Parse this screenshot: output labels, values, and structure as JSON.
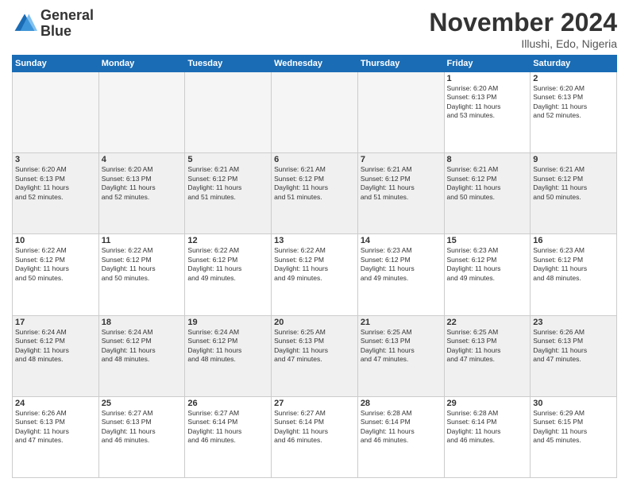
{
  "header": {
    "logo_line1": "General",
    "logo_line2": "Blue",
    "month": "November 2024",
    "location": "Illushi, Edo, Nigeria"
  },
  "weekdays": [
    "Sunday",
    "Monday",
    "Tuesday",
    "Wednesday",
    "Thursday",
    "Friday",
    "Saturday"
  ],
  "weeks": [
    [
      {
        "day": "",
        "text": ""
      },
      {
        "day": "",
        "text": ""
      },
      {
        "day": "",
        "text": ""
      },
      {
        "day": "",
        "text": ""
      },
      {
        "day": "",
        "text": ""
      },
      {
        "day": "1",
        "text": "Sunrise: 6:20 AM\nSunset: 6:13 PM\nDaylight: 11 hours\nand 53 minutes."
      },
      {
        "day": "2",
        "text": "Sunrise: 6:20 AM\nSunset: 6:13 PM\nDaylight: 11 hours\nand 52 minutes."
      }
    ],
    [
      {
        "day": "3",
        "text": "Sunrise: 6:20 AM\nSunset: 6:13 PM\nDaylight: 11 hours\nand 52 minutes."
      },
      {
        "day": "4",
        "text": "Sunrise: 6:20 AM\nSunset: 6:13 PM\nDaylight: 11 hours\nand 52 minutes."
      },
      {
        "day": "5",
        "text": "Sunrise: 6:21 AM\nSunset: 6:12 PM\nDaylight: 11 hours\nand 51 minutes."
      },
      {
        "day": "6",
        "text": "Sunrise: 6:21 AM\nSunset: 6:12 PM\nDaylight: 11 hours\nand 51 minutes."
      },
      {
        "day": "7",
        "text": "Sunrise: 6:21 AM\nSunset: 6:12 PM\nDaylight: 11 hours\nand 51 minutes."
      },
      {
        "day": "8",
        "text": "Sunrise: 6:21 AM\nSunset: 6:12 PM\nDaylight: 11 hours\nand 50 minutes."
      },
      {
        "day": "9",
        "text": "Sunrise: 6:21 AM\nSunset: 6:12 PM\nDaylight: 11 hours\nand 50 minutes."
      }
    ],
    [
      {
        "day": "10",
        "text": "Sunrise: 6:22 AM\nSunset: 6:12 PM\nDaylight: 11 hours\nand 50 minutes."
      },
      {
        "day": "11",
        "text": "Sunrise: 6:22 AM\nSunset: 6:12 PM\nDaylight: 11 hours\nand 50 minutes."
      },
      {
        "day": "12",
        "text": "Sunrise: 6:22 AM\nSunset: 6:12 PM\nDaylight: 11 hours\nand 49 minutes."
      },
      {
        "day": "13",
        "text": "Sunrise: 6:22 AM\nSunset: 6:12 PM\nDaylight: 11 hours\nand 49 minutes."
      },
      {
        "day": "14",
        "text": "Sunrise: 6:23 AM\nSunset: 6:12 PM\nDaylight: 11 hours\nand 49 minutes."
      },
      {
        "day": "15",
        "text": "Sunrise: 6:23 AM\nSunset: 6:12 PM\nDaylight: 11 hours\nand 49 minutes."
      },
      {
        "day": "16",
        "text": "Sunrise: 6:23 AM\nSunset: 6:12 PM\nDaylight: 11 hours\nand 48 minutes."
      }
    ],
    [
      {
        "day": "17",
        "text": "Sunrise: 6:24 AM\nSunset: 6:12 PM\nDaylight: 11 hours\nand 48 minutes."
      },
      {
        "day": "18",
        "text": "Sunrise: 6:24 AM\nSunset: 6:12 PM\nDaylight: 11 hours\nand 48 minutes."
      },
      {
        "day": "19",
        "text": "Sunrise: 6:24 AM\nSunset: 6:12 PM\nDaylight: 11 hours\nand 48 minutes."
      },
      {
        "day": "20",
        "text": "Sunrise: 6:25 AM\nSunset: 6:13 PM\nDaylight: 11 hours\nand 47 minutes."
      },
      {
        "day": "21",
        "text": "Sunrise: 6:25 AM\nSunset: 6:13 PM\nDaylight: 11 hours\nand 47 minutes."
      },
      {
        "day": "22",
        "text": "Sunrise: 6:25 AM\nSunset: 6:13 PM\nDaylight: 11 hours\nand 47 minutes."
      },
      {
        "day": "23",
        "text": "Sunrise: 6:26 AM\nSunset: 6:13 PM\nDaylight: 11 hours\nand 47 minutes."
      }
    ],
    [
      {
        "day": "24",
        "text": "Sunrise: 6:26 AM\nSunset: 6:13 PM\nDaylight: 11 hours\nand 47 minutes."
      },
      {
        "day": "25",
        "text": "Sunrise: 6:27 AM\nSunset: 6:13 PM\nDaylight: 11 hours\nand 46 minutes."
      },
      {
        "day": "26",
        "text": "Sunrise: 6:27 AM\nSunset: 6:14 PM\nDaylight: 11 hours\nand 46 minutes."
      },
      {
        "day": "27",
        "text": "Sunrise: 6:27 AM\nSunset: 6:14 PM\nDaylight: 11 hours\nand 46 minutes."
      },
      {
        "day": "28",
        "text": "Sunrise: 6:28 AM\nSunset: 6:14 PM\nDaylight: 11 hours\nand 46 minutes."
      },
      {
        "day": "29",
        "text": "Sunrise: 6:28 AM\nSunset: 6:14 PM\nDaylight: 11 hours\nand 46 minutes."
      },
      {
        "day": "30",
        "text": "Sunrise: 6:29 AM\nSunset: 6:15 PM\nDaylight: 11 hours\nand 45 minutes."
      }
    ]
  ]
}
